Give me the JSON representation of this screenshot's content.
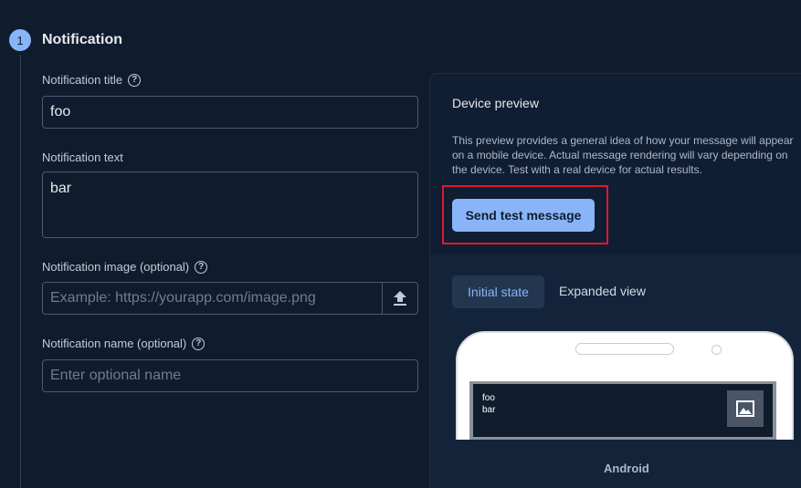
{
  "step": {
    "number": "1",
    "title": "Notification"
  },
  "form": {
    "title_label": "Notification title",
    "title_value": "foo",
    "text_label": "Notification text",
    "text_value": "bar",
    "image_label": "Notification image (optional)",
    "image_placeholder": "Example: https://yourapp.com/image.png",
    "name_label": "Notification name (optional)",
    "name_placeholder": "Enter optional name"
  },
  "preview": {
    "title": "Device preview",
    "description": "This preview provides a general idea of how your message will appear on a mobile device. Actual message rendering will vary depending on the device. Test with a real device for actual results.",
    "send_button": "Send test message",
    "tabs": [
      "Initial state",
      "Expanded view"
    ],
    "notification_title": "foo",
    "notification_text": "bar",
    "device_label": "Android"
  },
  "colors": {
    "background": "#0f1c2e",
    "accent": "#8ab4f8",
    "highlight": "#e0182b"
  }
}
